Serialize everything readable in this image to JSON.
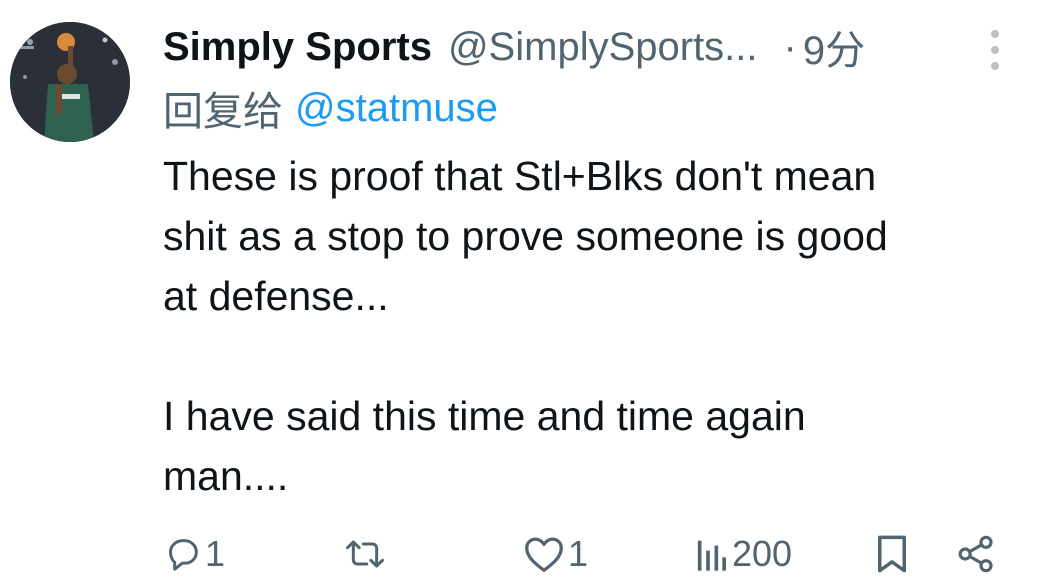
{
  "tweet": {
    "author_name": "Simply Sports",
    "author_handle": "@SimplySports...",
    "separator": "·",
    "time": "9分",
    "reply_label": "回复给",
    "reply_mention": "@statmuse",
    "text_lines": [
      "These is proof that Stl+Blks don't mean",
      "shit as a stop to prove someone is good",
      "at defense...",
      "",
      "I have said this time and time again",
      "man...."
    ]
  },
  "actions": {
    "reply_count": "1",
    "retweet_count": "",
    "like_count": "1",
    "view_count": "200"
  },
  "icons": {
    "reply": "reply-icon",
    "retweet": "retweet-icon",
    "like": "heart-icon",
    "views": "views-icon",
    "bookmark": "bookmark-icon",
    "share": "share-icon",
    "more": "more-options-icon"
  },
  "colors": {
    "text": "#0f1419",
    "secondary": "#536471",
    "mention": "#1d9bf0",
    "icon": "#536471"
  }
}
